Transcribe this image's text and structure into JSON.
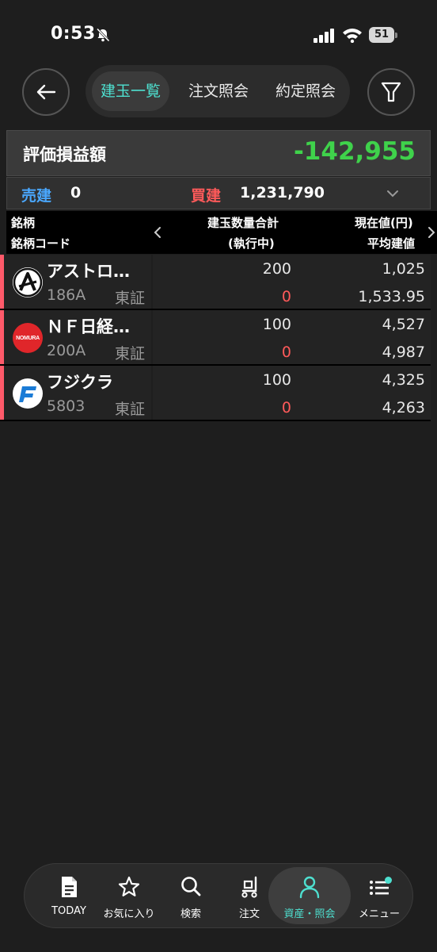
{
  "status_bar": {
    "time": "0:53",
    "battery": "51"
  },
  "nav": {
    "tabs": [
      {
        "label": "建玉一覧",
        "active": true
      },
      {
        "label": "注文照会",
        "active": false
      },
      {
        "label": "約定照会",
        "active": false
      }
    ]
  },
  "summary": {
    "pnl_label": "評価損益額",
    "pnl_value": "-142,955",
    "sell_label": "売建",
    "sell_value": "0",
    "buy_label": "買建",
    "buy_value": "1,231,790"
  },
  "table": {
    "headers": {
      "name": "銘柄",
      "code": "銘柄コード",
      "qty_total": "建玉数量合計",
      "pending": "(執行中)",
      "price": "現在値(円)",
      "avg": "平均建値"
    },
    "rows": [
      {
        "name": "アストロ…",
        "code": "186A",
        "market": "東証",
        "qty": "200",
        "pending": "0",
        "price": "1,025",
        "avg": "1,533.95",
        "logo": "astroscale-logo"
      },
      {
        "name": "ＮＦ日経…",
        "code": "200A",
        "market": "東証",
        "qty": "100",
        "pending": "0",
        "price": "4,527",
        "avg": "4,987",
        "logo": "nomura-logo",
        "logo_text": "NOMURA"
      },
      {
        "name": "フジクラ",
        "code": "5803",
        "market": "東証",
        "qty": "100",
        "pending": "0",
        "price": "4,325",
        "avg": "4,263",
        "logo": "fujikura-logo"
      }
    ]
  },
  "bottom_nav": {
    "items": [
      {
        "label": "TODAY",
        "icon": "document-icon"
      },
      {
        "label": "お気に入り",
        "icon": "star-icon"
      },
      {
        "label": "検索",
        "icon": "search-icon"
      },
      {
        "label": "注文",
        "icon": "cart-icon"
      },
      {
        "label": "資産・照会",
        "icon": "person-icon",
        "active": true
      },
      {
        "label": "メニュー",
        "icon": "list-icon"
      }
    ]
  },
  "colors": {
    "accent": "#4ee0d0",
    "profit_negative": "#3fd24b",
    "sell": "#4aa8ff",
    "buy": "#ff5a5a",
    "row_marker": "#ff5a6a"
  }
}
